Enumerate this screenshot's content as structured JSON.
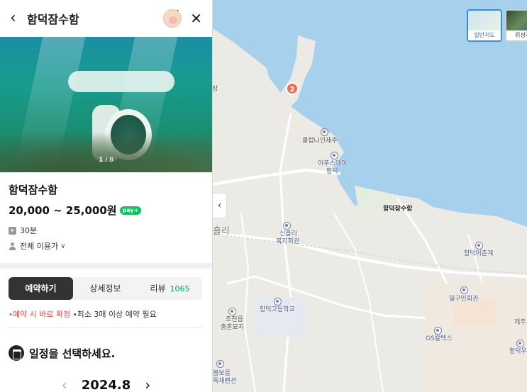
{
  "panel": {
    "title": "함덕잠수함",
    "my_tag": "my",
    "photo_counter_current": "1",
    "photo_counter_total": "/ 8",
    "place_name": "함덕잠수함",
    "price": "20,000 ~ 25,000원",
    "npay_label": "pay+",
    "duration": "30분",
    "audience": "전체 이용가",
    "tabs": [
      {
        "label": "예약하기"
      },
      {
        "label": "상세정보"
      },
      {
        "label": "리뷰",
        "count": "1065"
      }
    ],
    "notice_instant": "예약 시 바로 확정",
    "notice_min": "최소 3매 이상 예약 필요",
    "schedule_title": "일정을 선택하세요.",
    "month": "2024.8"
  },
  "map": {
    "maptypes": [
      "일반지도",
      "위성지"
    ],
    "cluster_count": "2",
    "labels": {
      "club": "클럽나인제주",
      "stay": "어푸스테이",
      "stay2": "함덕",
      "pin": "함덕잠수함",
      "dong": "신흘리",
      "dong2": "복지회관",
      "heulri": "흘리",
      "ojang": "장",
      "hamdeok_eochon": "함덕어촌계",
      "ilgu": "일구민회관",
      "school": "함덕고등학교",
      "cemetery": "조천읍",
      "cemetery2": "충혼묘지",
      "gs": "GS칼텍스",
      "jeju": "제주",
      "hamdeok_u": "함덕우체",
      "pension": "봄보름",
      "pension2": "독채펜션"
    }
  },
  "colors": {
    "sea": "#a7d0ec",
    "accent_green": "#03c75a",
    "pin_red": "#f0584a"
  }
}
